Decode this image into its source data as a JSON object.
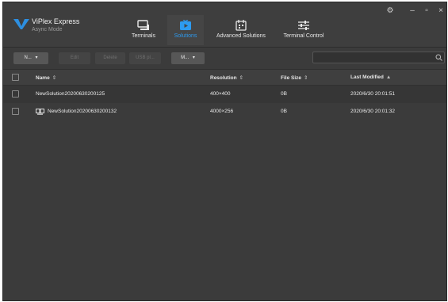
{
  "app": {
    "name": "ViPlex Express",
    "mode": "Async Mode"
  },
  "nav": [
    {
      "label": "Terminals",
      "icon": "monitor-icon"
    },
    {
      "label": "Solutions",
      "icon": "solution-play-icon",
      "active": true
    },
    {
      "label": "Advanced Solutions",
      "icon": "calendar-icon"
    },
    {
      "label": "Terminal Control",
      "icon": "sliders-icon"
    }
  ],
  "window_controls": {
    "settings": "⚙",
    "minimize": "–",
    "maximize": "▫",
    "close": "×"
  },
  "toolbar": {
    "new_label": "N...",
    "edit_label": "Edit",
    "delete_label": "Delete",
    "usb_label": "USB pl...",
    "more_label": "M...",
    "dropdown_arrow": "▾",
    "search_placeholder": ""
  },
  "table": {
    "columns": [
      {
        "label": "Name",
        "sort": "⇕"
      },
      {
        "label": "Resolution",
        "sort": "⇕"
      },
      {
        "label": "File Size",
        "sort": "⇕"
      },
      {
        "label": "Last Modified",
        "sort": "▲"
      }
    ],
    "rows": [
      {
        "name": "NewSolution20200630200125",
        "resolution": "400×400",
        "size": "0B",
        "modified": "2020/6/30 20:01:51",
        "icon": ""
      },
      {
        "name": "NewSolution20200630200132",
        "resolution": "4000×256",
        "size": "0B",
        "modified": "2020/6/30 20:01:32",
        "icon": "multi-screen-icon"
      }
    ]
  },
  "colors": {
    "background": "#3b3b3b",
    "accent": "#2d9bf0",
    "logo": "#2d8fe0"
  }
}
